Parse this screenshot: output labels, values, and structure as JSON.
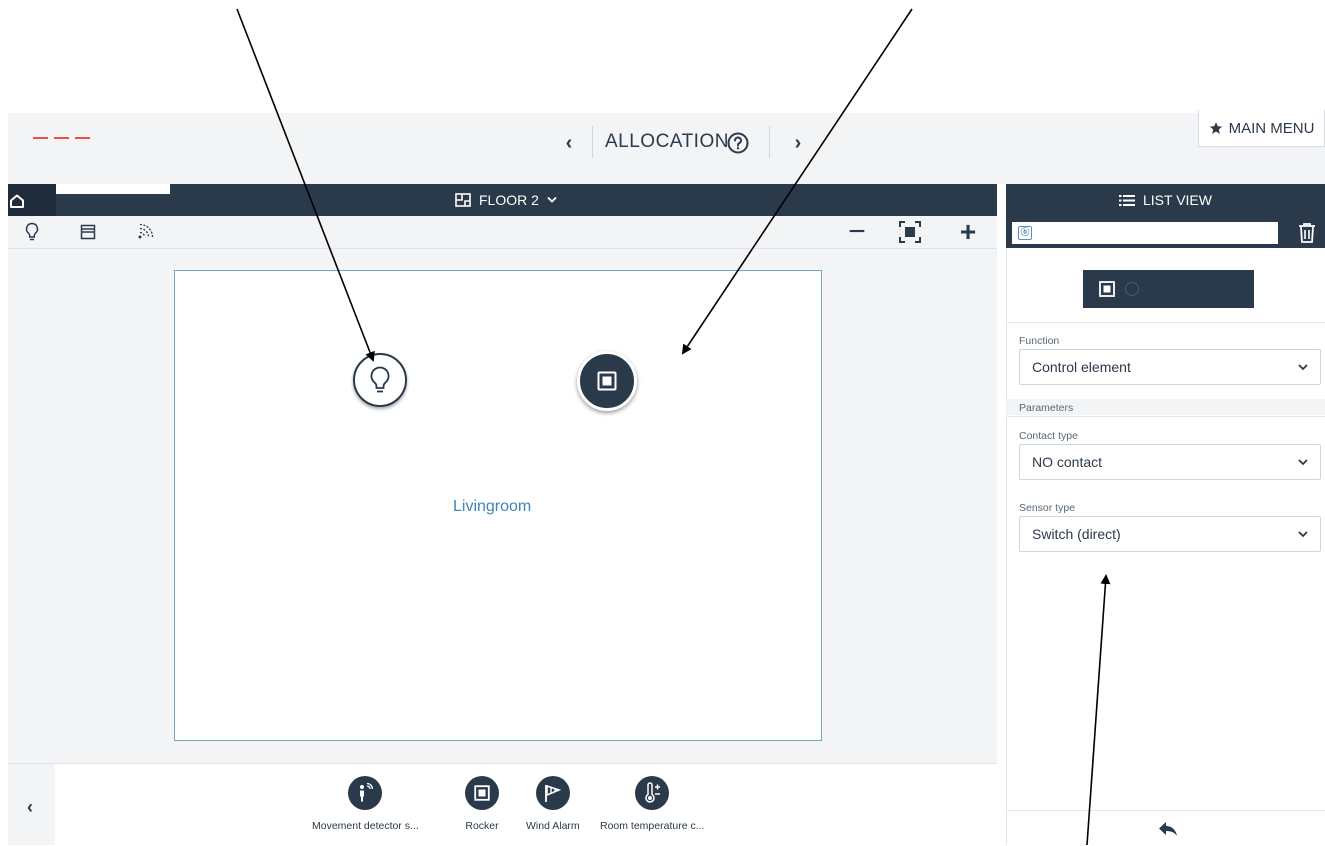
{
  "header": {
    "title": "ALLOCATION",
    "prev_label": "‹",
    "next_label": "›",
    "help_icon": "help-circle-icon",
    "main_menu_label": "MAIN MENU",
    "main_menu_icon": "star-icon"
  },
  "floor_bar": {
    "home_icon": "home-icon",
    "floor_label": "FLOOR 2",
    "floor_icon": "floorplan-icon",
    "floor_dropdown_icon": "chevron-down-icon"
  },
  "toolbar": {
    "tools": [
      "lightbulb-icon",
      "blind-icon",
      "wireless-signal-icon"
    ],
    "zoom_out_label": "−",
    "zoom_in_label": "+",
    "zoom_fit_icon": "fit-screen-icon"
  },
  "canvas": {
    "room_name": "Livingroom",
    "devices": [
      {
        "name": "light",
        "icon": "lightbulb-icon"
      },
      {
        "name": "rocker",
        "icon": "rocker-icon"
      }
    ]
  },
  "tray": {
    "prev_label": "‹",
    "items": [
      {
        "label": "Movement detector s...",
        "icon": "movement-detector-icon"
      },
      {
        "label": "Rocker",
        "icon": "rocker-icon"
      },
      {
        "label": "Wind Alarm",
        "icon": "wind-sock-icon"
      },
      {
        "label": "Room temperature c...",
        "icon": "thermometer-icon"
      }
    ]
  },
  "right_panel": {
    "list_view_label": "LIST VIEW",
    "list_view_icon": "list-icon",
    "channel_input_value": "",
    "channel_badge": "ⓑ",
    "delete_icon": "trash-icon",
    "function": {
      "label": "Function",
      "value": "Control element"
    },
    "parameters_label": "Parameters",
    "contact_type": {
      "label": "Contact type",
      "value": "NO contact"
    },
    "sensor_type": {
      "label": "Sensor type",
      "value": "Switch (direct)"
    },
    "back_icon": "reply-arrow-icon"
  },
  "colors": {
    "navy": "#2b3a4a",
    "accent_blue": "#3d88b8",
    "room_border": "#6fa7cc",
    "logo_red": "#e8504c",
    "panel_gray": "#f3f4f6"
  }
}
